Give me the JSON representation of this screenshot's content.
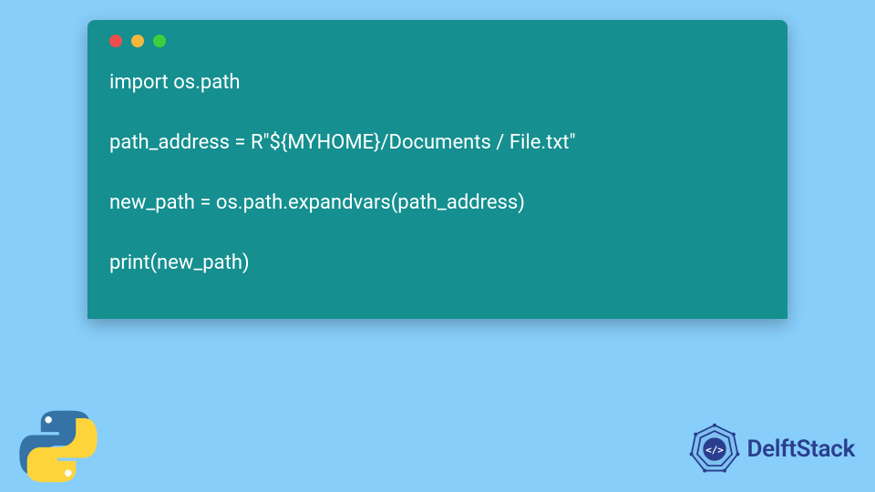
{
  "code": {
    "lines": [
      "import os.path",
      "",
      "path_address = R\"${MYHOME}/Documents / File.txt\"",
      "",
      "new_path = os.path.expandvars(path_address)",
      "",
      "print(new_path)"
    ]
  },
  "branding": {
    "site_name": "DelftStack"
  },
  "colors": {
    "background": "#87cefa",
    "code_block": "#158f8f",
    "code_text": "#ffffff",
    "brand": "#2a3e8f"
  }
}
